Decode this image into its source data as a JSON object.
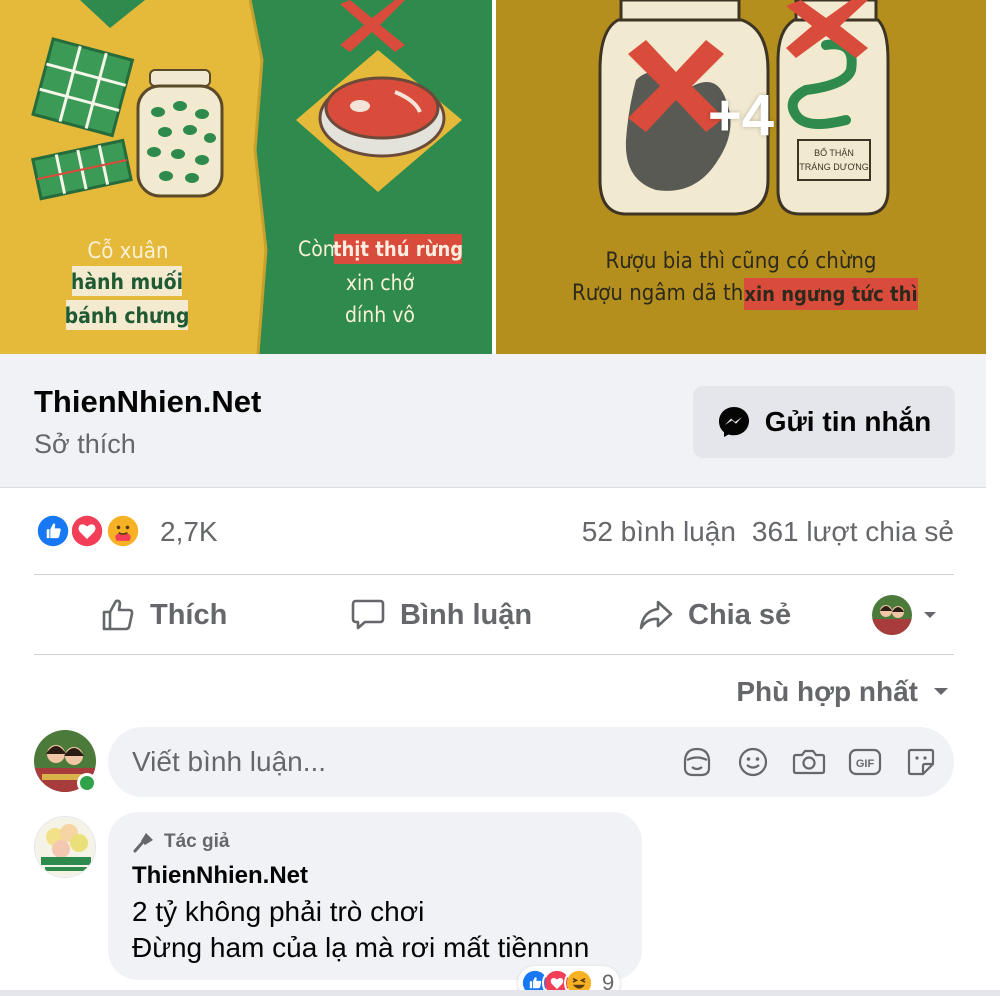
{
  "media": {
    "left_caption": {
      "line1": "Cỗ xuân",
      "line2": "hành muối",
      "line3": "bánh chưng"
    },
    "middle_caption": {
      "prefix": "Còn",
      "highlight": "thịt thú rừng",
      "line2": "xin chớ",
      "line3": "dính vô"
    },
    "right_caption": {
      "line1": "Rượu bia thì cũng có chừng",
      "line2_prefix": "Rượu ngâm dã thú",
      "line2_highlight": "xin ngưng tức thì"
    },
    "jar_label": {
      "line1": "BỔ THẬN",
      "line2": "TRÁNG DƯƠNG"
    },
    "more_count": "+4",
    "colors": {
      "mustard": "#e5b93a",
      "green": "#2f8a4e",
      "olive": "#b58f1e",
      "red": "#d94b3a"
    }
  },
  "page": {
    "name": "ThienNhien.Net",
    "category": "Sở thích",
    "message_button": "Gửi tin nhắn"
  },
  "summary": {
    "reaction_icons": [
      "like-icon",
      "love-icon",
      "care-icon"
    ],
    "reaction_count": "2,7K",
    "comments": "52 bình luận",
    "shares": "361 lượt chia sẻ"
  },
  "actions": {
    "like": "Thích",
    "comment": "Bình luận",
    "share": "Chia sẻ"
  },
  "sort": {
    "label": "Phù hợp nhất"
  },
  "composer": {
    "placeholder": "Viết bình luận...",
    "tools": [
      "avatar-sticker-icon",
      "emoji-icon",
      "camera-icon",
      "gif-icon",
      "sticker-icon"
    ]
  },
  "comment": {
    "badge": "Tác giả",
    "author": "ThienNhien.Net",
    "line1": "2 tỷ không phải trò chơi",
    "line2": "Đừng ham của lạ mà rơi mất tiềnnnn",
    "reaction_count": "9"
  },
  "colors": {
    "accent": "#1877f2",
    "muted": "#65676b",
    "surface": "#f0f2f5"
  }
}
